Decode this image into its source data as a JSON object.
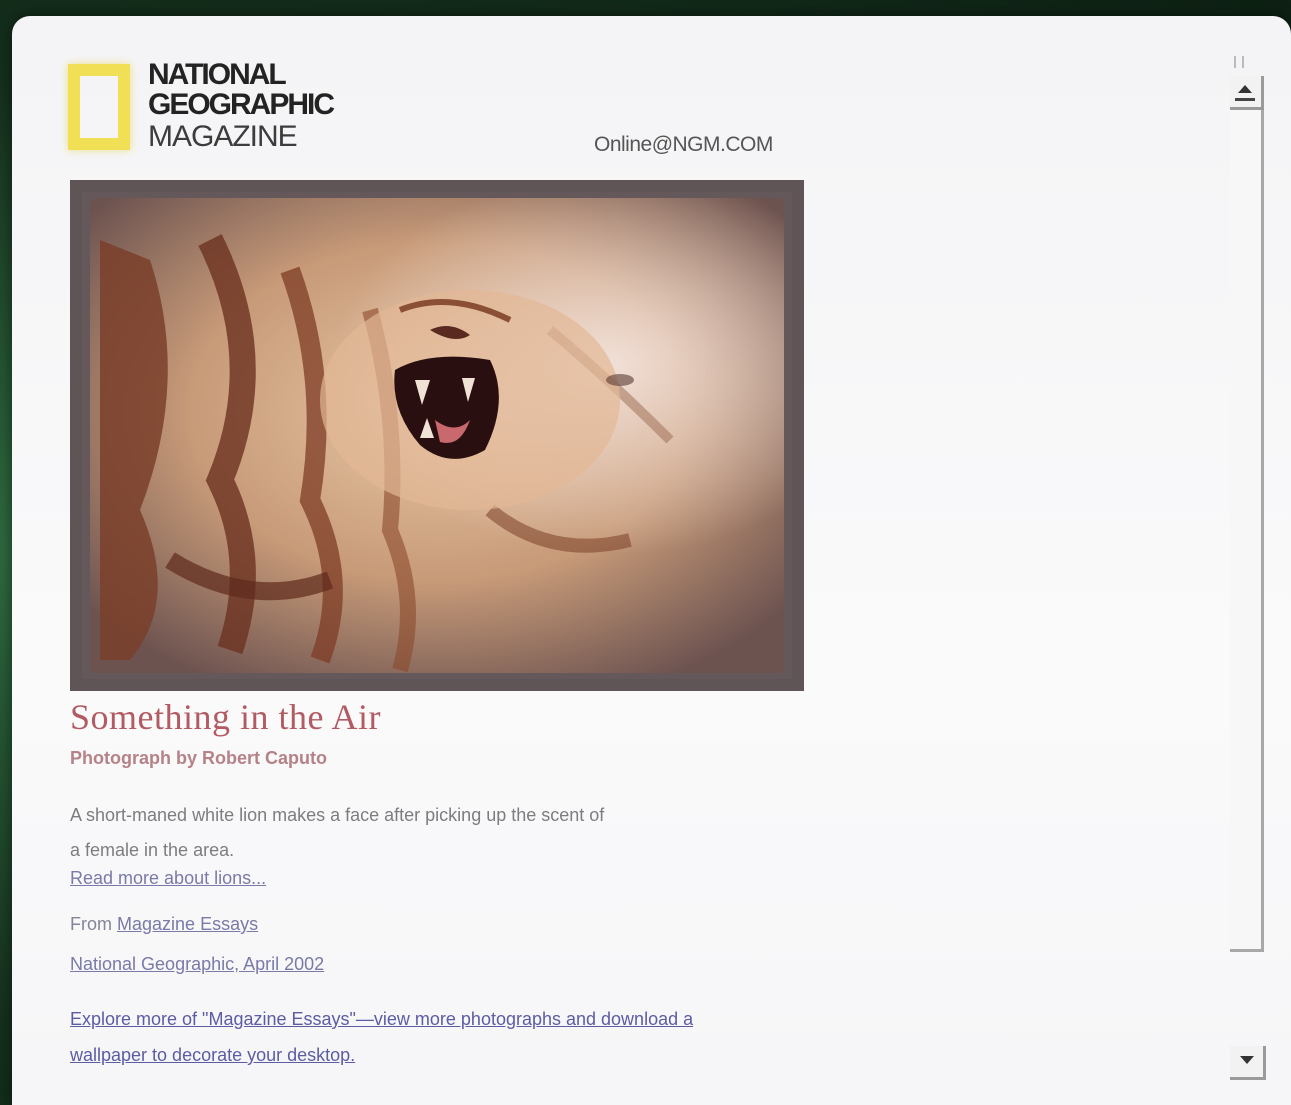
{
  "logo": {
    "line1": "NATIONAL",
    "line2": "GEOGRAPHIC",
    "line3": "MAGAZINE"
  },
  "header": {
    "online_link": "Online@NGM.COM"
  },
  "photo": {
    "alt": "Lion roaring"
  },
  "story": {
    "headline": "Something in the Air",
    "credit": "Photograph by Robert Caputo",
    "description": "A short-maned white lion makes a face after picking up the scent of a female in the area.",
    "read_more": "Read more about lions..."
  },
  "source": {
    "from_label": "From",
    "from_link": "Magazine Essays",
    "issue_link": "National Geographic, April 2002"
  },
  "explore_link": "Explore more of \"Magazine Essays\"—view more photographs and download a wallpaper to decorate your desktop.",
  "colors": {
    "headline": "#b25b62",
    "credit": "#b48287",
    "link": "#7a7aa8",
    "logo_yellow": "#f1df55"
  },
  "icons": {
    "scroll_up": "triangle-up",
    "scroll_down": "triangle-down"
  }
}
